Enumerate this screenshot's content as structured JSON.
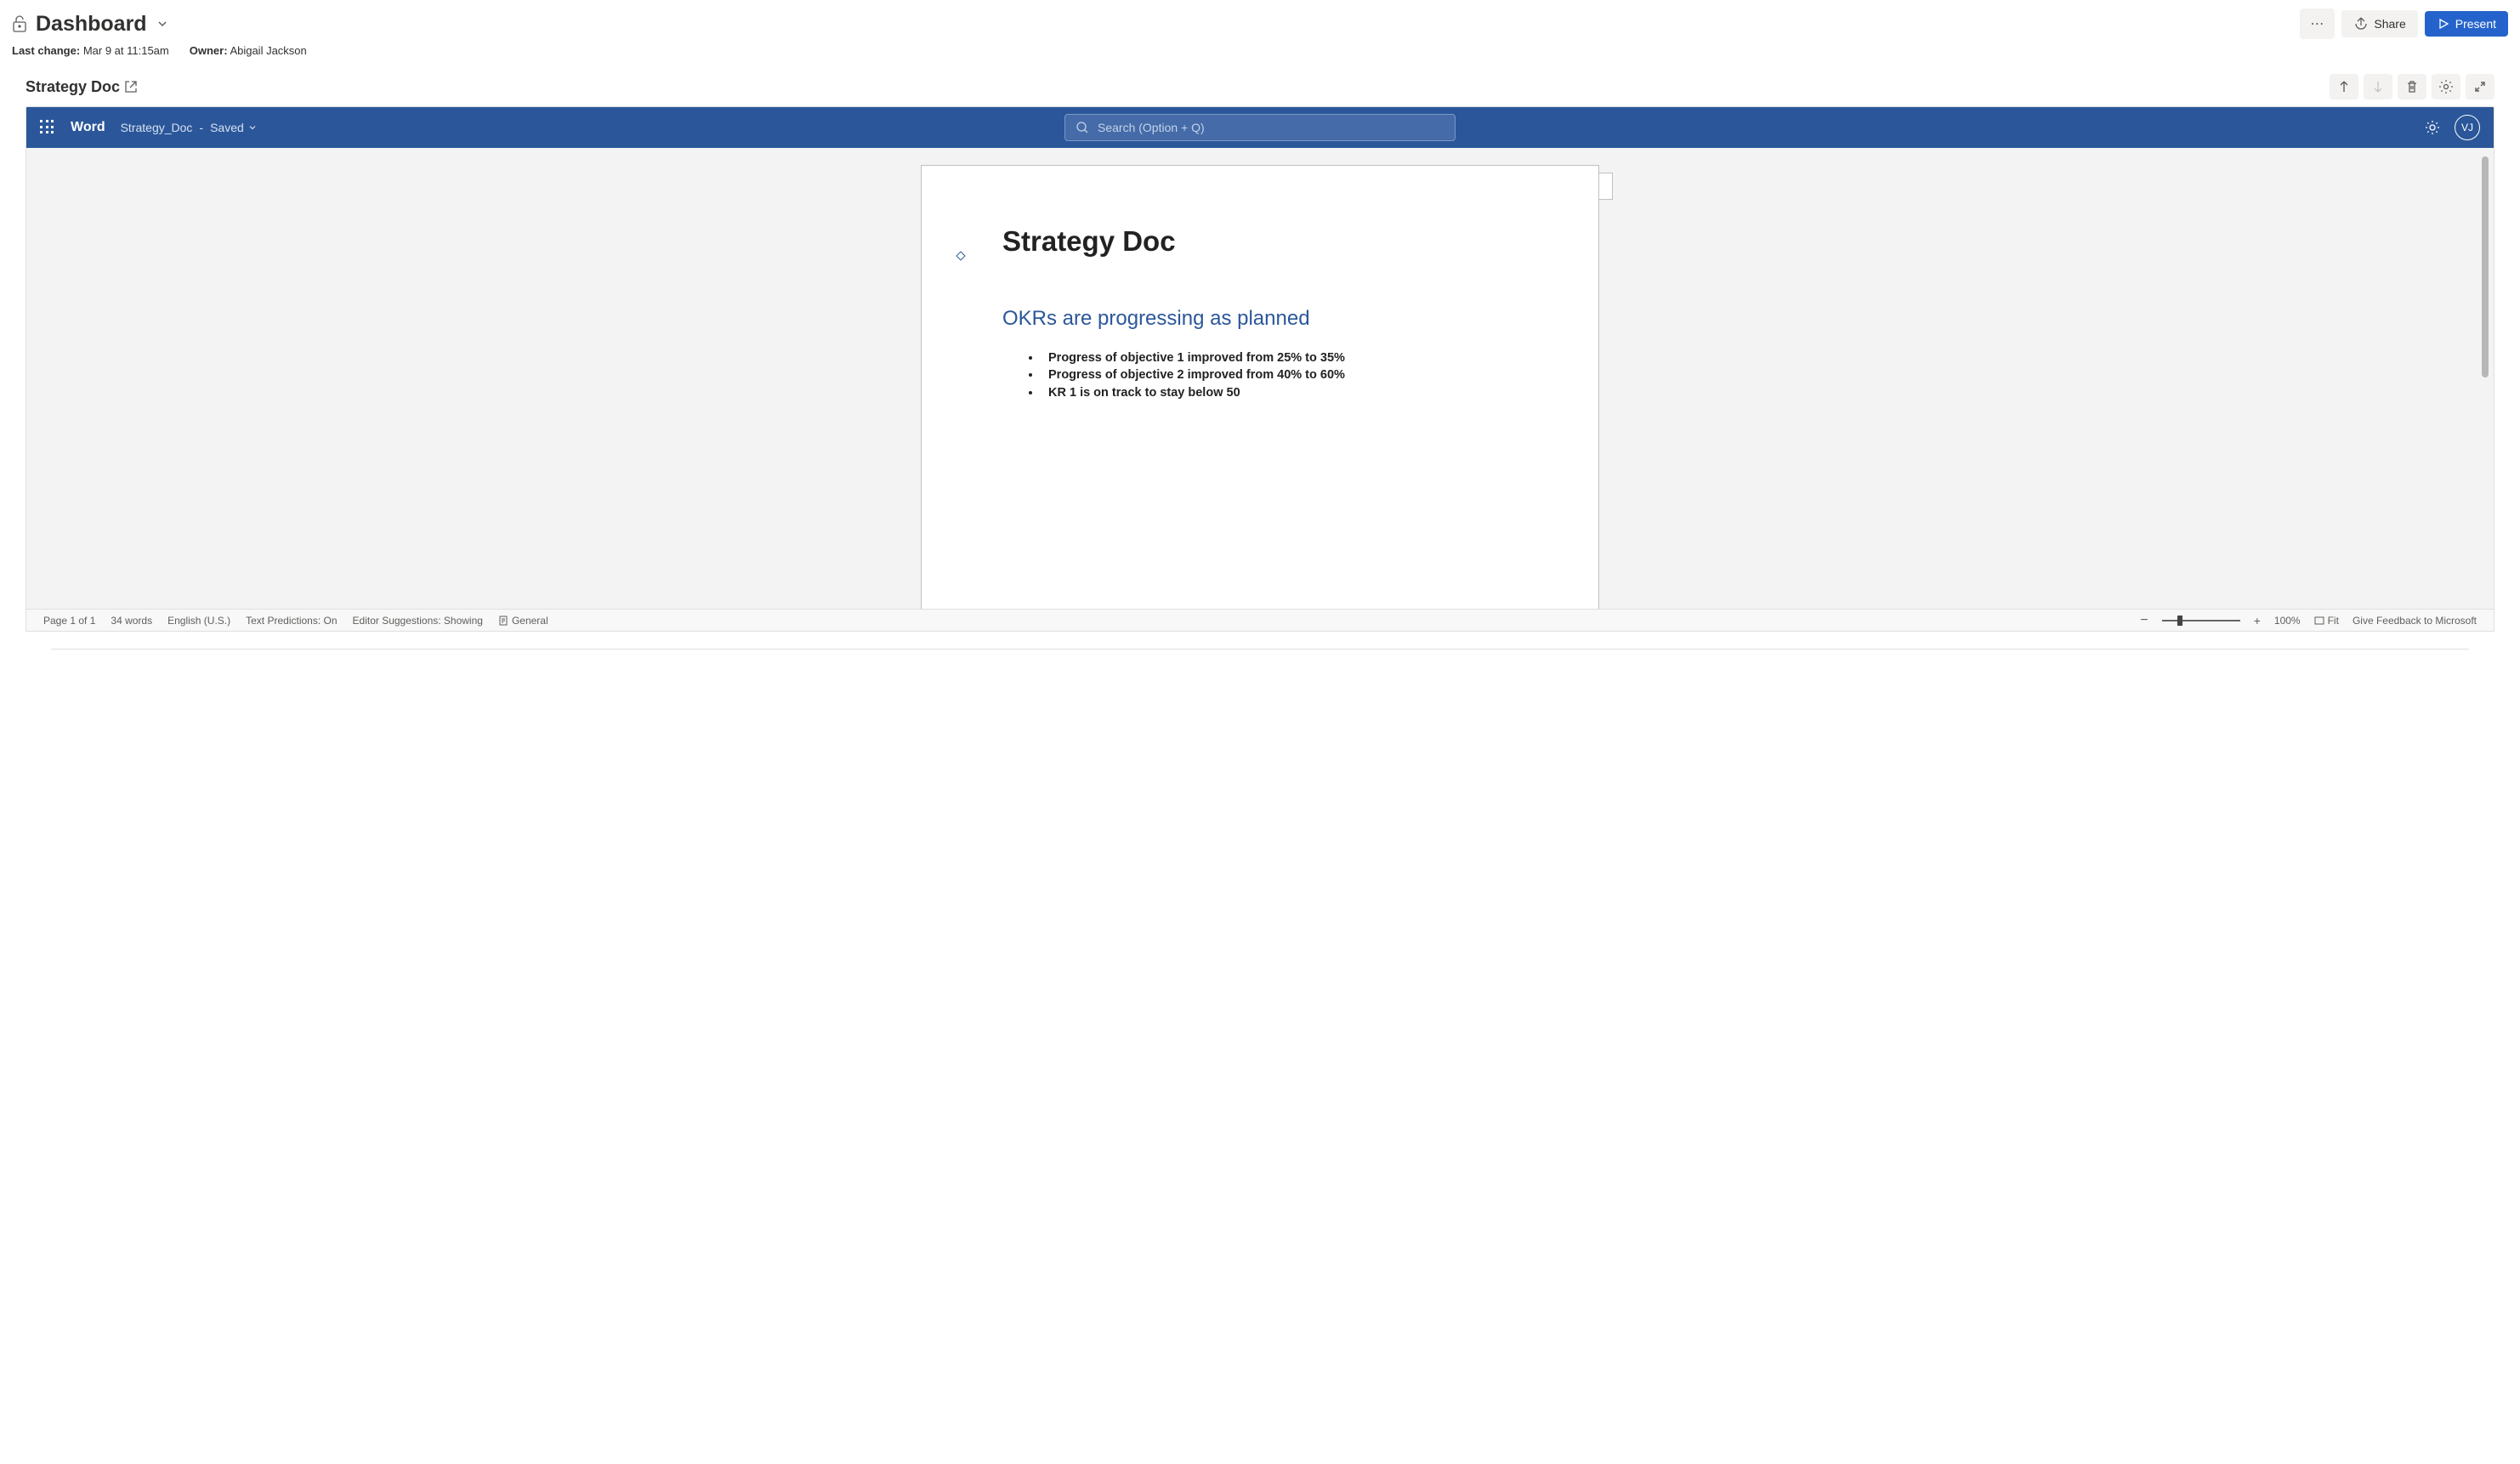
{
  "header": {
    "title": "Dashboard",
    "more_label": "⋯",
    "share_label": "Share",
    "present_label": "Present"
  },
  "meta": {
    "last_change_label": "Last change:",
    "last_change_value": "Mar 9 at 11:15am",
    "owner_label": "Owner:",
    "owner_value": "Abigail Jackson"
  },
  "section": {
    "title": "Strategy Doc"
  },
  "word": {
    "brand": "Word",
    "filename": "Strategy_Doc",
    "separator": "-",
    "save_state": "Saved",
    "search_placeholder": "Search (Option + Q)",
    "avatar_initials": "VJ"
  },
  "document": {
    "heading1": "Strategy Doc",
    "heading2": "OKRs are progressing as planned",
    "bullets": [
      "Progress of objective 1 improved from 25% to 35%",
      "Progress of objective 2 improved from 40% to 60%",
      "KR 1 is on track to stay below 50"
    ]
  },
  "status": {
    "page": "Page 1 of 1",
    "words": "34 words",
    "language": "English (U.S.)",
    "text_predictions": "Text Predictions: On",
    "editor_suggestions": "Editor Suggestions: Showing",
    "general": "General",
    "zoom": "100%",
    "fit": "Fit",
    "feedback": "Give Feedback to Microsoft"
  }
}
